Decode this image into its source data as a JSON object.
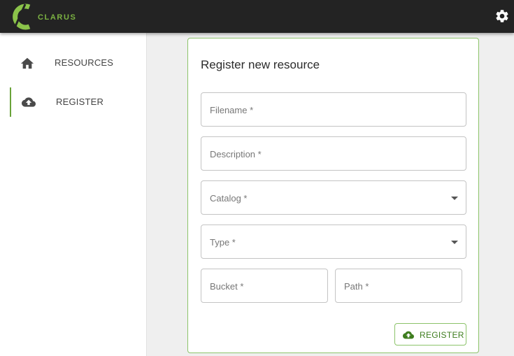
{
  "app": {
    "brand": "CLARUS",
    "accent": "#7cb342",
    "header_bg": "#232323"
  },
  "header": {
    "settings_icon": "gear-icon"
  },
  "sidebar": {
    "items": [
      {
        "label": "RESOURCES",
        "icon": "home-icon",
        "active": false
      },
      {
        "label": "REGISTER",
        "icon": "cloud-upload-icon",
        "active": true
      }
    ]
  },
  "form": {
    "title": "Register new resource",
    "fields": {
      "filename": {
        "placeholder": "Filename *",
        "value": ""
      },
      "description": {
        "placeholder": "Description *",
        "value": ""
      },
      "catalog": {
        "placeholder": "Catalog *",
        "value": ""
      },
      "type": {
        "placeholder": "Type *",
        "value": ""
      },
      "bucket": {
        "placeholder": "Bucket *",
        "value": ""
      },
      "path": {
        "placeholder": "Path *",
        "value": ""
      }
    },
    "submit_label": "REGISTER"
  }
}
